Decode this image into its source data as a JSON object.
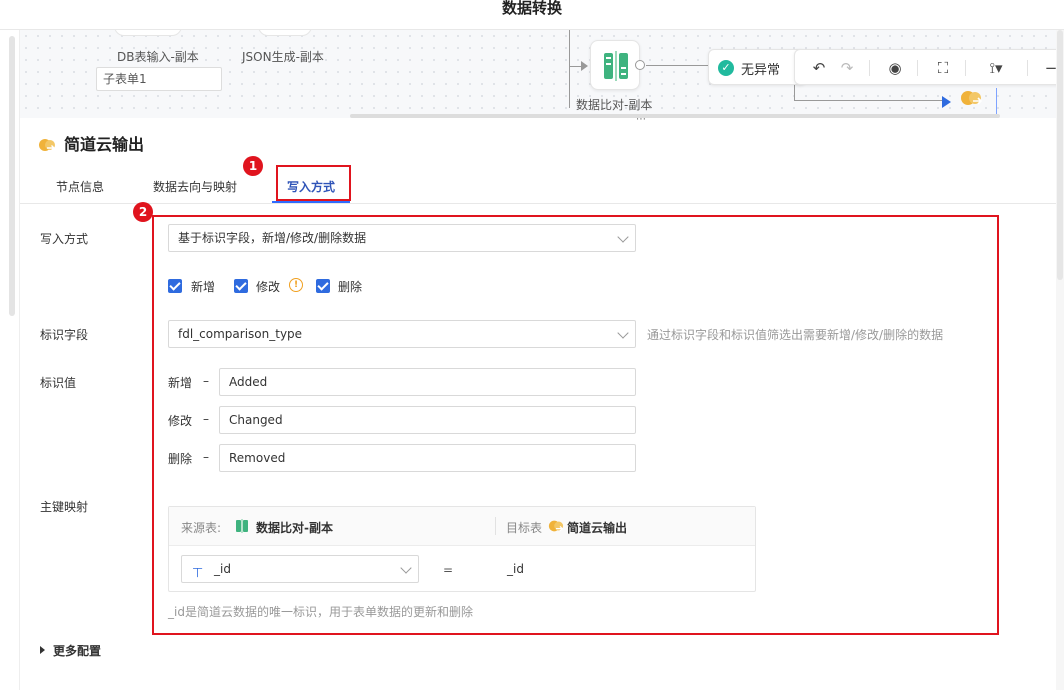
{
  "app": {
    "title": "数据转换"
  },
  "canvas": {
    "node_db_label": "DB表输入-副本",
    "node_json_label": "JSON生成-副本",
    "subform_value": "子表单1",
    "compare_node_label": "数据比对-副本",
    "status_text": "无异常",
    "toolbar": {
      "undo_icon": "undo-icon",
      "redo_icon": "redo-icon",
      "preview_icon": "eye-icon",
      "fit_icon": "fit-screen-icon",
      "route_icon": "route-icon",
      "zoom_out_icon": "minus-icon"
    }
  },
  "panel": {
    "title": "简道云输出",
    "tabs": [
      {
        "label": "节点信息"
      },
      {
        "label": "数据去向与映射"
      },
      {
        "label": "写入方式",
        "active": true
      }
    ],
    "badges": [
      "1",
      "2"
    ],
    "form": {
      "write_mode_label": "写入方式",
      "write_mode_value": "基于标识字段，新增/修改/删除数据",
      "checkboxes": [
        {
          "label": "新增",
          "checked": true
        },
        {
          "label": "修改",
          "checked": true
        },
        {
          "label": "删除",
          "checked": true
        }
      ],
      "id_field_label": "标识字段",
      "id_field_value": "fdl_comparison_type",
      "id_field_hint": "通过标识字段和标识值筛选出需要新增/修改/删除的数据",
      "id_value_label": "标识值",
      "id_values": [
        {
          "label": "新增",
          "sep": "–",
          "value": "Added"
        },
        {
          "label": "修改",
          "sep": "–",
          "value": "Changed"
        },
        {
          "label": "删除",
          "sep": "–",
          "value": "Removed"
        }
      ],
      "pk_label": "主键映射",
      "pk_table": {
        "source_key": "来源表:",
        "source_name": "数据比对-副本",
        "target_key": "目标表",
        "target_name": "简道云输出",
        "source_field": "_id",
        "equals": "=",
        "target_field": "_id"
      },
      "pk_hint": "_id是简道云数据的唯一标识，用于表单数据的更新和删除"
    },
    "more_config": "更多配置"
  },
  "colors": {
    "accent": "#2f6bdf",
    "highlight": "#e0141e",
    "ok": "#21ba9e"
  }
}
